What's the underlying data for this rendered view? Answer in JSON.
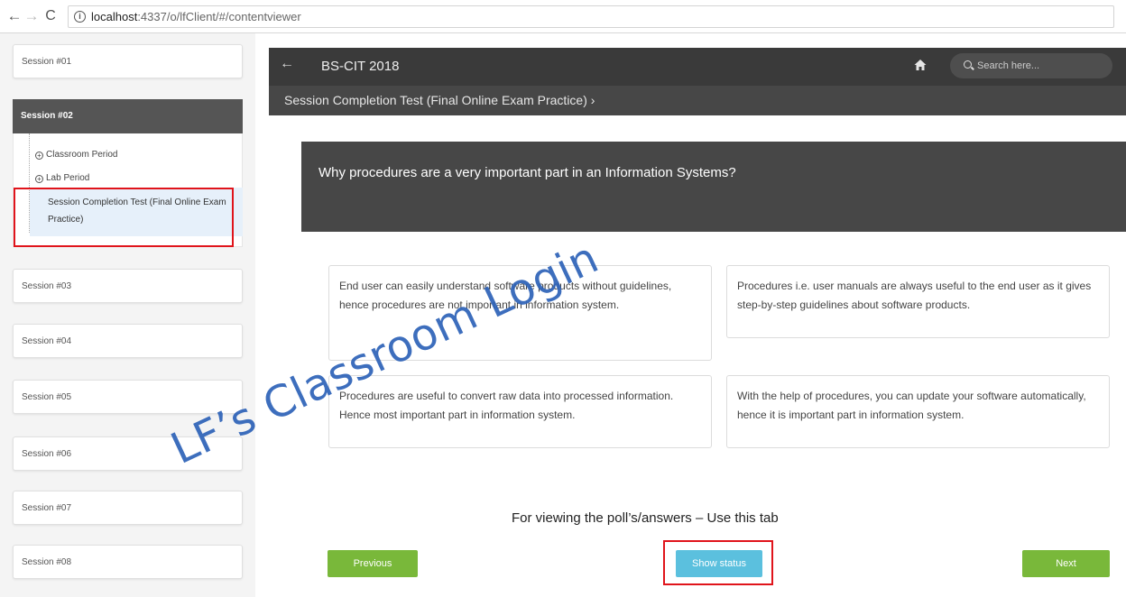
{
  "browser": {
    "url_host": "localhost",
    "url_rest": ":4337/o/lfClient/#/contentviewer",
    "info_symbol": "i"
  },
  "sidebar": {
    "sessions_before": [
      {
        "label": "Session #01"
      }
    ],
    "active_session": {
      "label": "Session #02",
      "items": [
        {
          "label": "Classroom Period"
        },
        {
          "label": "Lab Period"
        },
        {
          "label": "Session Completion Test (Final Online Exam Practice)"
        }
      ]
    },
    "sessions_after": [
      {
        "label": "Session #03"
      },
      {
        "label": "Session #04"
      },
      {
        "label": "Session #05"
      },
      {
        "label": "Session #06"
      },
      {
        "label": "Session #07"
      },
      {
        "label": "Session #08"
      }
    ]
  },
  "header": {
    "title": "BS-CIT 2018",
    "search_placeholder": "Search here..."
  },
  "breadcrumb": "Session Completion Test (Final Online Exam Practice) ›",
  "question": "Why procedures are a very important part in an Information Systems?",
  "options": [
    {
      "text": "End user can easily understand software products without guidelines, hence procedures are not important in information system."
    },
    {
      "text": "Procedures i.e. user manuals are always useful to the end user as it gives step-by-step guidelines about software products."
    },
    {
      "text": "Procedures are useful to convert raw data into processed information. Hence most important part in information system."
    },
    {
      "text": "With the help of procedures, you can update your software automatically, hence it is important part in information system."
    }
  ],
  "watermark": "LF’s Classroom Login",
  "annotation_hint": "For viewing the poll’s/answers – Use this tab",
  "buttons": {
    "previous": "Previous",
    "show_status": "Show status",
    "next": "Next"
  },
  "colors": {
    "highlight_border": "#e0141b",
    "button_green": "#79b83a",
    "button_blue": "#5bc0de",
    "header_dark": "#3a3a3a"
  }
}
